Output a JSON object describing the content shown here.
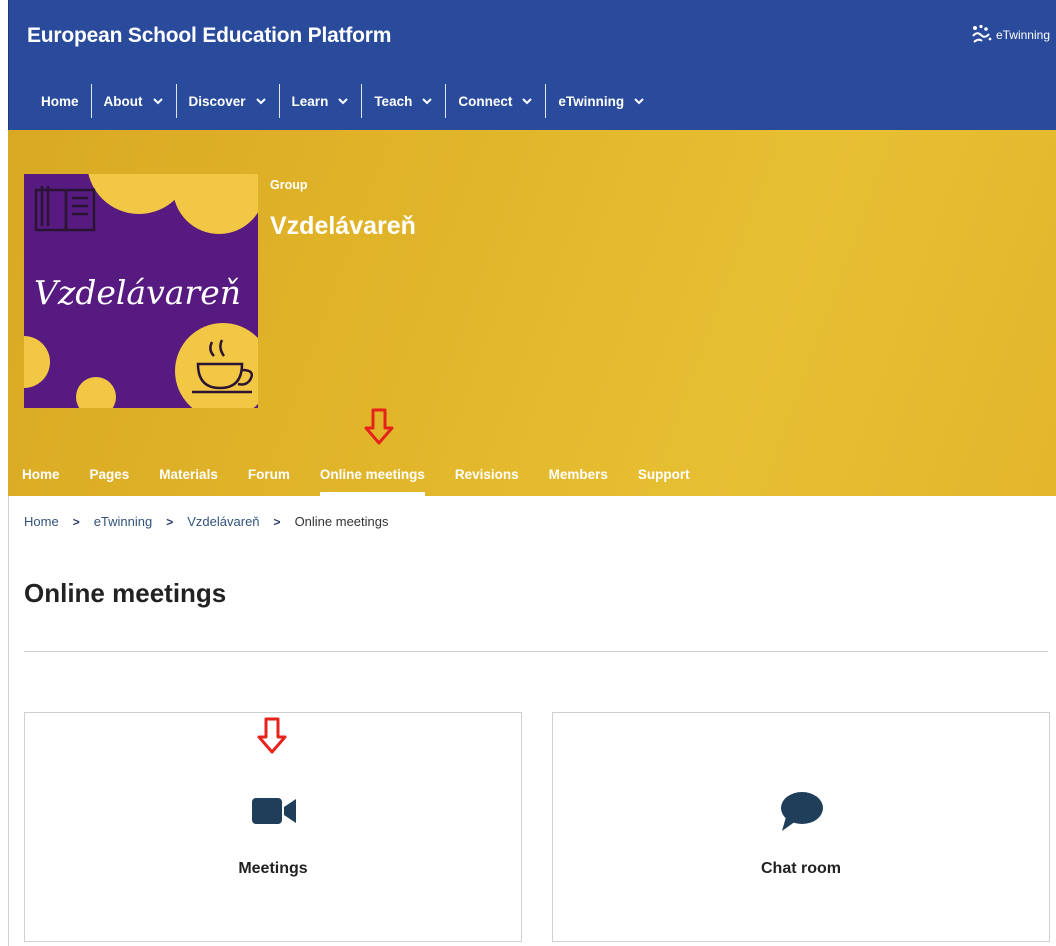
{
  "header": {
    "site_title": "European School Education Platform",
    "brand": "eTwinning",
    "nav": [
      {
        "label": "Home",
        "has_dropdown": false
      },
      {
        "label": "About",
        "has_dropdown": true
      },
      {
        "label": "Discover",
        "has_dropdown": true
      },
      {
        "label": "Learn",
        "has_dropdown": true
      },
      {
        "label": "Teach",
        "has_dropdown": true
      },
      {
        "label": "Connect",
        "has_dropdown": true
      },
      {
        "label": "eTwinning",
        "has_dropdown": true
      }
    ]
  },
  "banner": {
    "logo_text": "Vzdelávareň",
    "group_label": "Group",
    "group_title": "Vzdelávareň",
    "tabs": [
      {
        "label": "Home"
      },
      {
        "label": "Pages"
      },
      {
        "label": "Materials"
      },
      {
        "label": "Forum"
      },
      {
        "label": "Online meetings",
        "active": true
      },
      {
        "label": "Revisions"
      },
      {
        "label": "Members"
      },
      {
        "label": "Support"
      }
    ]
  },
  "breadcrumb": [
    "Home",
    "eTwinning",
    "Vzdelávareň",
    "Online meetings"
  ],
  "page": {
    "title": "Online meetings",
    "cards": [
      {
        "label": "Meetings",
        "icon": "video-camera-icon"
      },
      {
        "label": "Chat room",
        "icon": "chat-bubble-icon"
      }
    ]
  },
  "colors": {
    "header_blue": "#2a4b9b",
    "banner_yellow": "#e1b52a",
    "logo_purple": "#571a80",
    "icon_navy": "#1f3e5a",
    "annotation_red": "#e5231b"
  }
}
